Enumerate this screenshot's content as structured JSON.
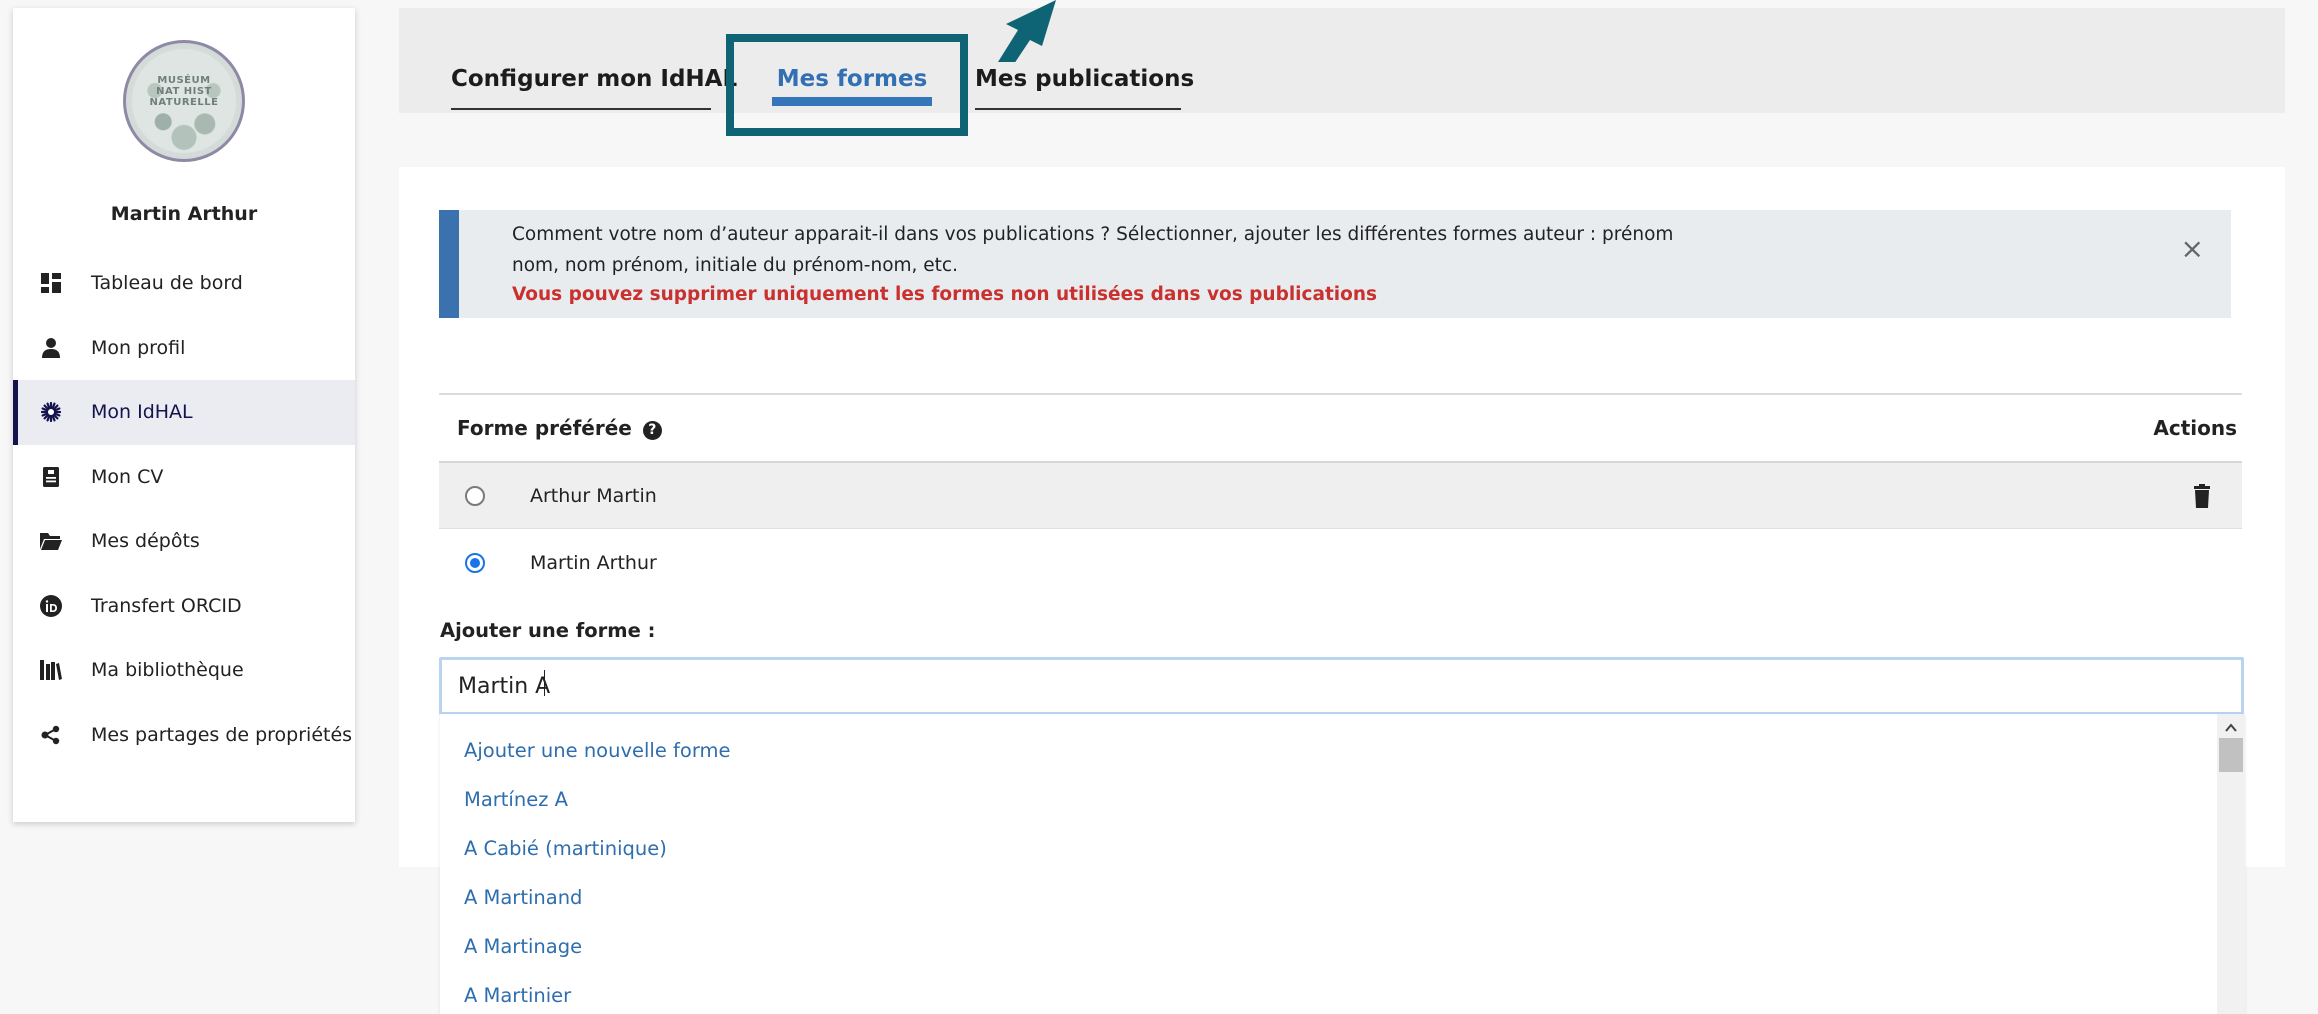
{
  "sidebar": {
    "logo_text": [
      "MUSÉUM",
      "NAT HIST",
      "NATURELLE"
    ],
    "profile_name": "Martin Arthur",
    "items": [
      {
        "label": "Tableau de bord",
        "icon": "dashboard-icon",
        "active": false
      },
      {
        "label": "Mon profil",
        "icon": "user-icon",
        "active": false
      },
      {
        "label": "Mon IdHAL",
        "icon": "idhal-icon",
        "active": true
      },
      {
        "label": "Mon CV",
        "icon": "cv-icon",
        "active": false
      },
      {
        "label": "Mes dépôts",
        "icon": "folder-icon",
        "active": false
      },
      {
        "label": "Transfert ORCID",
        "icon": "orcid-icon",
        "active": false
      },
      {
        "label": "Ma bibliothèque",
        "icon": "library-icon",
        "active": false
      },
      {
        "label": "Mes partages de propriétés",
        "icon": "share-icon",
        "active": false
      }
    ]
  },
  "tabs": [
    {
      "label": "Configurer mon IdHAL",
      "active": false
    },
    {
      "label": "Mes formes",
      "active": true
    },
    {
      "label": "Mes publications",
      "active": false
    }
  ],
  "alert": {
    "line1": "Comment votre nom d’auteur apparait-il dans vos publications ? Sélectionner, ajouter les différentes formes auteur : prénom",
    "line2": "nom, nom prénom, initiale du prénom-nom, etc.",
    "line3": "Vous pouvez supprimer uniquement les formes non utilisées dans vos publications",
    "close": "×"
  },
  "table": {
    "header_forme": "Forme préférée",
    "header_actions": "Actions",
    "rows": [
      {
        "name": "Arthur Martin",
        "selected": false,
        "deletable": true
      },
      {
        "name": "Martin Arthur",
        "selected": true,
        "deletable": false
      }
    ]
  },
  "add_form": {
    "label": "Ajouter une forme :",
    "value": "Martin A"
  },
  "dropdown": {
    "items": [
      "Ajouter une nouvelle forme",
      "Martínez A",
      "A Cabié (martinique)",
      "A Martinand",
      "A Martinage",
      "A Martinier"
    ]
  },
  "colors": {
    "active_tab": "#3270b3",
    "highlight": "#0e6374",
    "alert_border": "#3b72ad",
    "warning_text": "#c9312f",
    "sidebar_active": "#13134e",
    "link": "#2f6eae"
  }
}
